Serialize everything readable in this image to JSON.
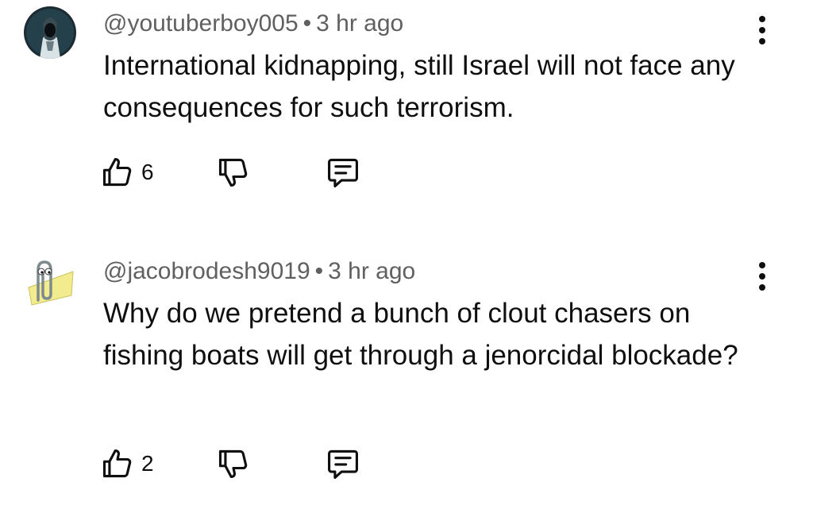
{
  "comments": [
    {
      "handle": "@youtuberboy005",
      "separator": "•",
      "time": "3 hr ago",
      "text": "International kidnapping, still Israel will not face any consequences for such terrorism.",
      "likes": "6",
      "avatar": "hooded-figure-avatar"
    },
    {
      "handle": "@jacobrodesh9019",
      "separator": "•",
      "time": "3 hr ago",
      "text": "Why do we pretend a bunch of clout chasers on fishing boats will get through a jenorcidal blockade?",
      "likes": "2",
      "avatar": "paperclip-avatar"
    }
  ],
  "icons": {
    "like": "thumbs-up-icon",
    "dislike": "thumbs-down-icon",
    "reply": "comment-icon",
    "more": "more-vertical-icon"
  },
  "colors": {
    "text": "#0f0f0f",
    "meta": "#606060",
    "background": "#ffffff"
  }
}
